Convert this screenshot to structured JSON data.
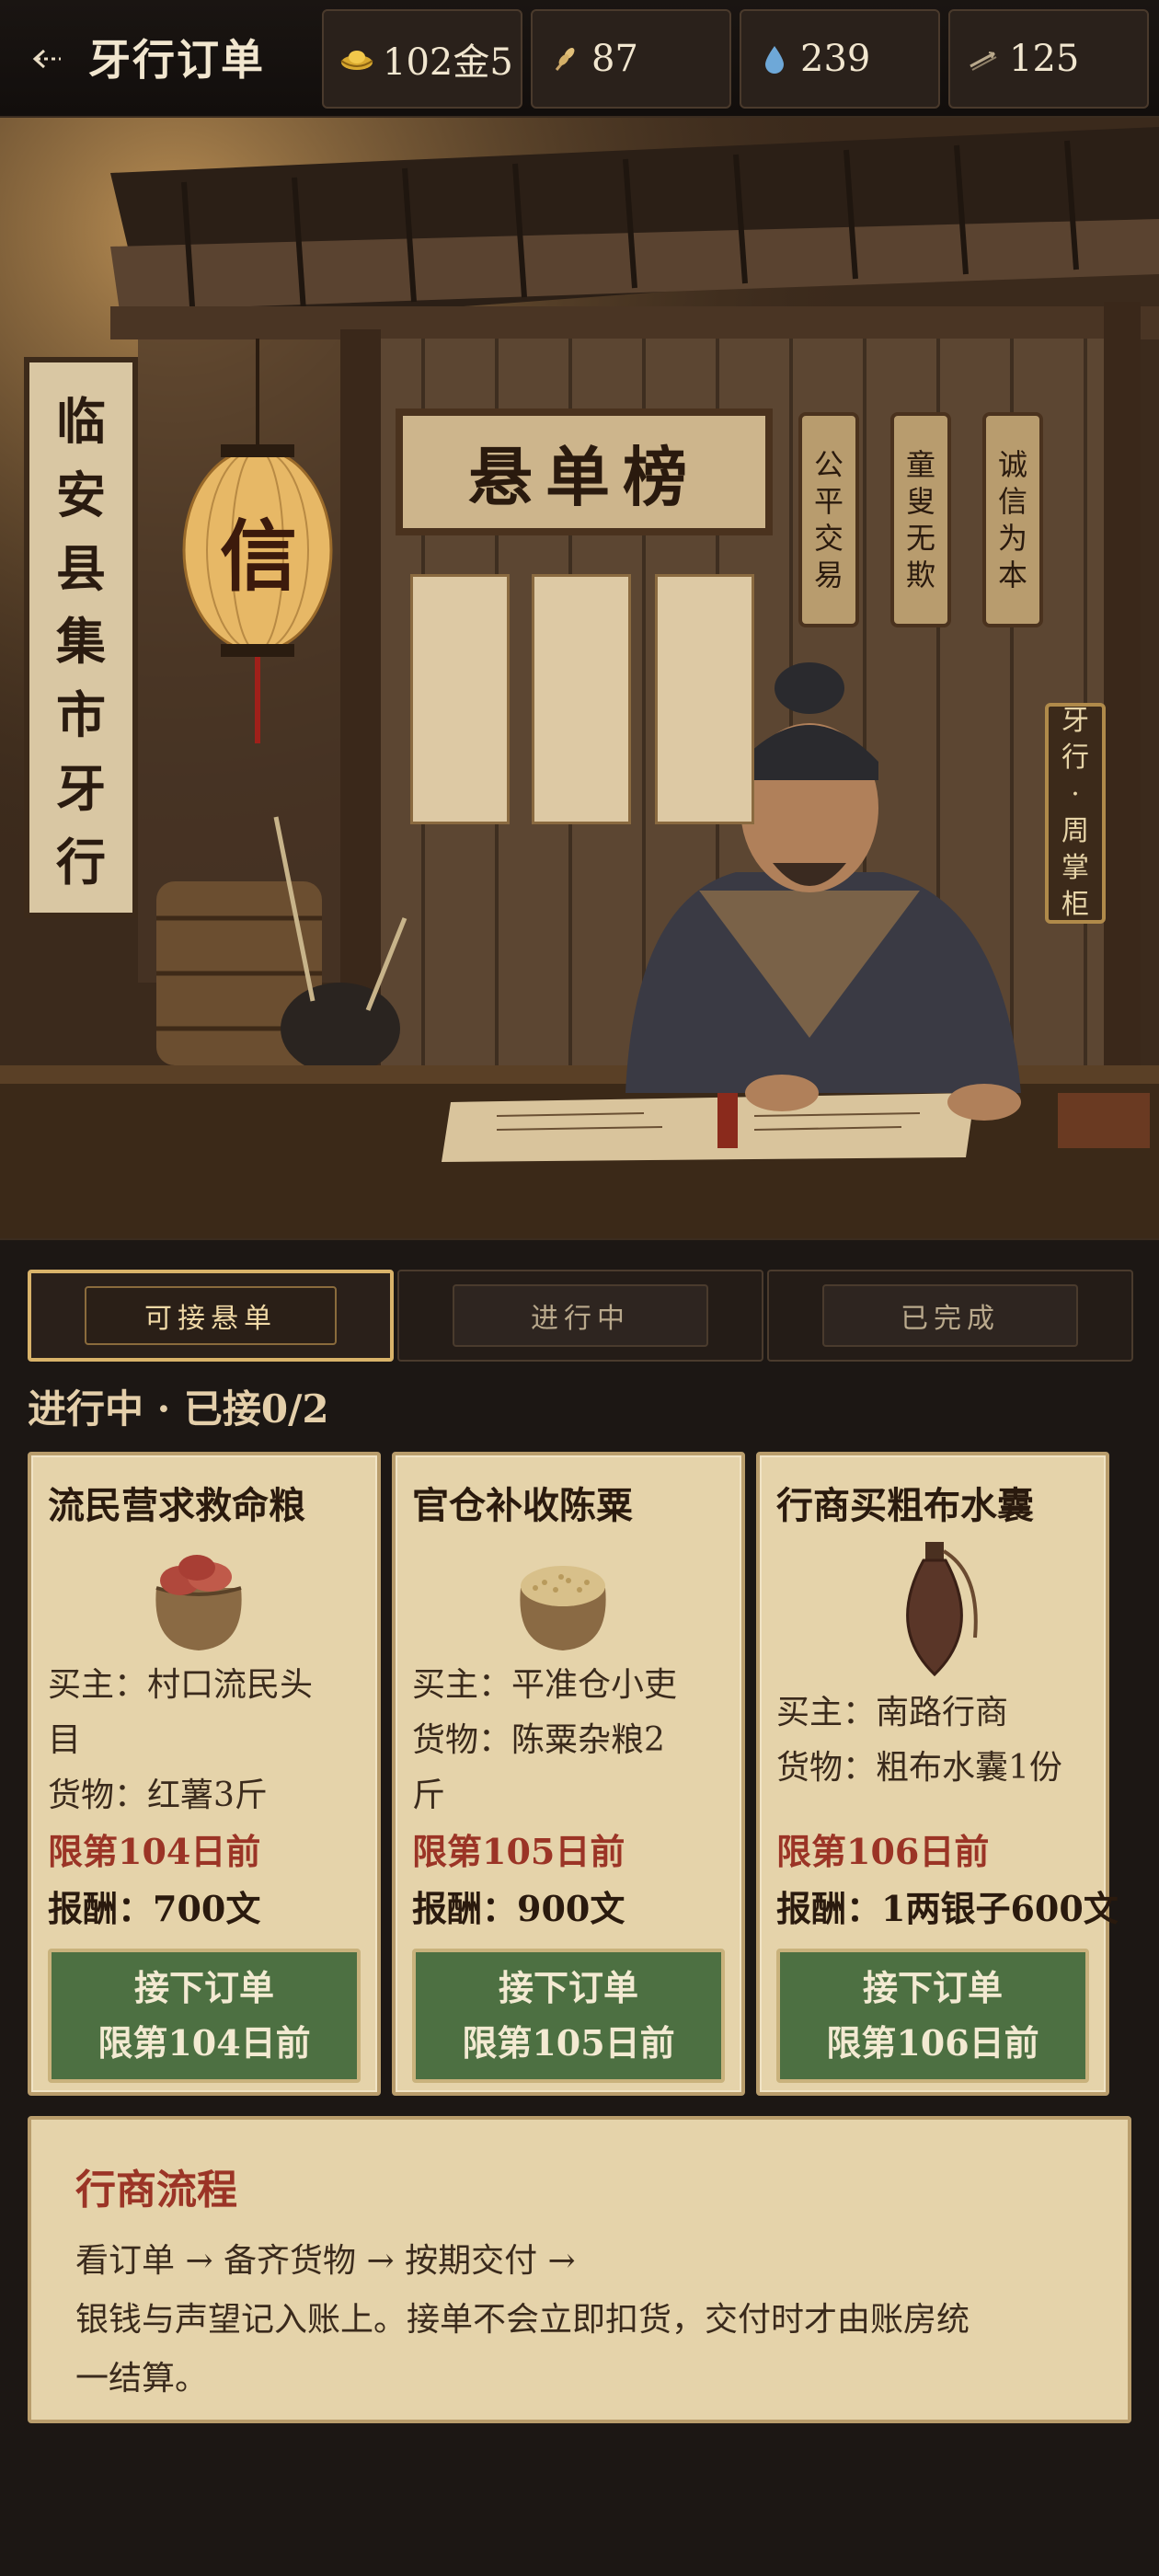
{
  "header": {
    "title": "牙行订单",
    "resources": [
      {
        "icon": "gold-ingot-icon",
        "value": "102金5"
      },
      {
        "icon": "grain-icon",
        "value": "87"
      },
      {
        "icon": "water-drop-icon",
        "value": "239"
      },
      {
        "icon": "arrow-icon",
        "value": "125"
      }
    ]
  },
  "scene": {
    "banner": [
      "临",
      "安",
      "县",
      "集",
      "市",
      "牙",
      "行"
    ],
    "lantern": "信",
    "board_title": "悬单榜",
    "tags": [
      [
        "公",
        "平",
        "交",
        "易"
      ],
      [
        "童",
        "叟",
        "无",
        "欺"
      ],
      [
        "诚",
        "信",
        "为",
        "本"
      ]
    ],
    "name_tag": [
      "牙",
      "行",
      "·",
      "周",
      "掌",
      "柜"
    ]
  },
  "tabs": [
    {
      "label": "可接悬单",
      "active": true
    },
    {
      "label": "进行中",
      "active": false
    },
    {
      "label": "已完成",
      "active": false
    }
  ],
  "status": "进行中 · 已接0/2",
  "orders": [
    {
      "title": "流民营求救命粮",
      "item_icon": "sweet-potato-sack-icon",
      "lines": [
        "买主：村口流民头",
        "目",
        "货物：红薯3斤"
      ],
      "deadline": "限第104日前",
      "reward": "报酬：700文",
      "button": {
        "label": "接下订单",
        "sub": "限第104日前"
      }
    },
    {
      "title": "官仓补收陈粟",
      "item_icon": "millet-sack-icon",
      "lines": [
        "买主：平准仓小吏",
        "货物：陈粟杂粮2",
        "斤"
      ],
      "deadline": "限第105日前",
      "reward": "报酬：900文",
      "button": {
        "label": "接下订单",
        "sub": "限第105日前"
      }
    },
    {
      "title": "行商买粗布水囊",
      "item_icon": "water-flask-icon",
      "lines": [
        "买主：南路行商",
        "货物：粗布水囊1份"
      ],
      "deadline": "限第106日前",
      "reward": "报酬：1两银子600文",
      "button": {
        "label": "接下订单",
        "sub": "限第106日前"
      }
    }
  ],
  "process": {
    "title": "行商流程",
    "lines": [
      "看订单 → 备齐货物 → 按期交付 →",
      "银钱与声望记入账上。接单不会立即扣货，交付时才由账房统",
      "一结算。"
    ]
  },
  "colors": {
    "accent_gold": "#d9b36a",
    "deadline_red": "#9b3426",
    "button_green": "#4d7042",
    "parchment": "#e5d3aa"
  }
}
